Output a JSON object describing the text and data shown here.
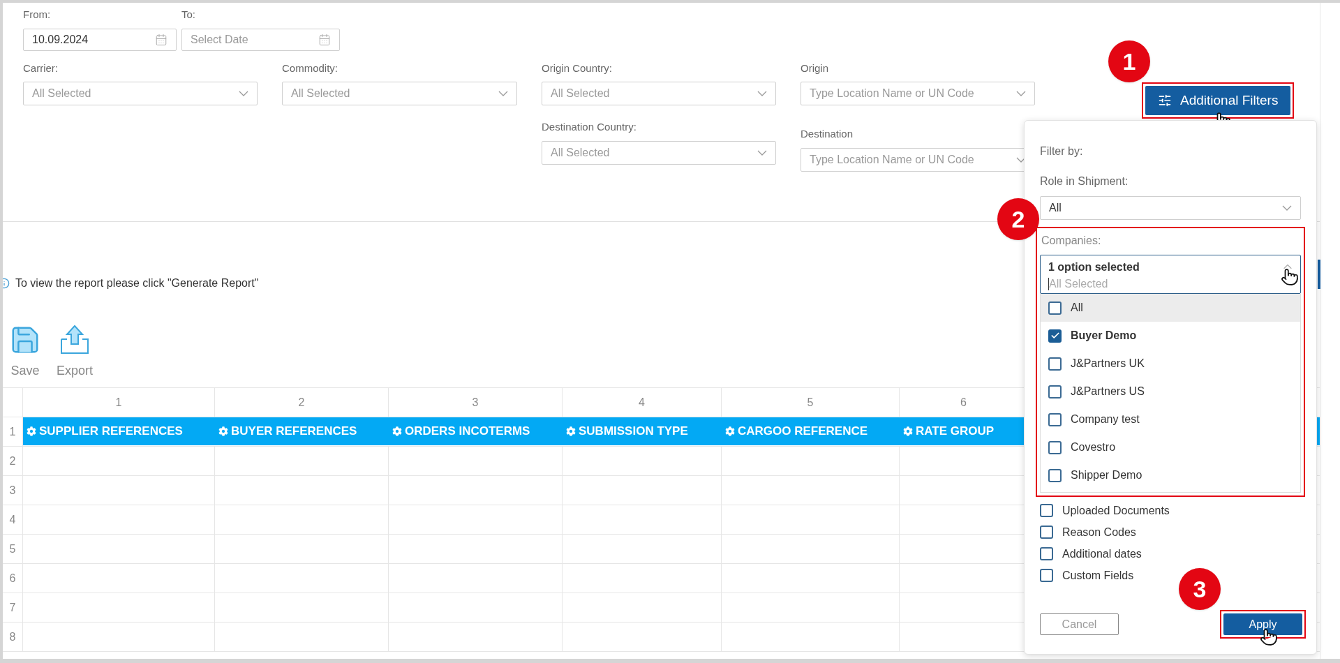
{
  "date_range": {
    "from": {
      "label": "From:",
      "value": "10.09.2024"
    },
    "to": {
      "label": "To:",
      "placeholder": "Select Date"
    }
  },
  "filters": [
    {
      "label": "Carrier:",
      "placeholder": "All Selected"
    },
    {
      "label": "Commodity:",
      "placeholder": "All Selected"
    },
    {
      "label": "Origin Country:",
      "placeholder": "All Selected"
    },
    {
      "label": "Origin",
      "placeholder": "Type Location Name or UN Code"
    },
    {
      "label": "Destination Country:",
      "placeholder": "All Selected"
    },
    {
      "label": "Destination",
      "placeholder": "Type Location Name or UN Code"
    }
  ],
  "additional_filters_button": "Additional Filters",
  "info_message": "To view the report please click \"Generate Report\"",
  "toolbar": [
    {
      "kind": "save",
      "label": "Save"
    },
    {
      "kind": "export",
      "label": "Export"
    }
  ],
  "table": {
    "column_numbers": [
      "1",
      "2",
      "3",
      "4",
      "5",
      "6"
    ],
    "columns": [
      "SUPPLIER REFERENCES",
      "BUYER REFERENCES",
      "ORDERS INCOTERMS",
      "SUBMISSION TYPE",
      "CARGOO REFERENCE",
      "RATE GROUP"
    ],
    "row_numbers": [
      "1",
      "2",
      "3",
      "4",
      "5",
      "6",
      "7",
      "8"
    ]
  },
  "filter_popup": {
    "title": "Filter by:",
    "role": {
      "label": "Role in Shipment:",
      "value": "All"
    },
    "companies": {
      "label": "Companies:",
      "summary": "1 option selected",
      "placeholder": "All Selected",
      "expanded": true,
      "options": [
        {
          "label": "All",
          "checked": false,
          "highlighted": true
        },
        {
          "label": "Buyer Demo",
          "checked": true,
          "highlighted": false
        },
        {
          "label": "J&Partners UK",
          "checked": false,
          "highlighted": false
        },
        {
          "label": "J&Partners US",
          "checked": false,
          "highlighted": false
        },
        {
          "label": "Company test",
          "checked": false,
          "highlighted": false
        },
        {
          "label": "Covestro",
          "checked": false,
          "highlighted": false
        },
        {
          "label": "Shipper Demo",
          "checked": false,
          "highlighted": false
        }
      ]
    },
    "sections": [
      {
        "label": "Uploaded Documents",
        "checked": false
      },
      {
        "label": "Reason Codes",
        "checked": false
      },
      {
        "label": "Additional dates",
        "checked": false
      },
      {
        "label": "Custom Fields",
        "checked": false
      }
    ],
    "cancel": "Cancel",
    "apply": "Apply"
  },
  "annotations": [
    {
      "label": "1"
    },
    {
      "label": "2"
    },
    {
      "label": "3"
    }
  ]
}
